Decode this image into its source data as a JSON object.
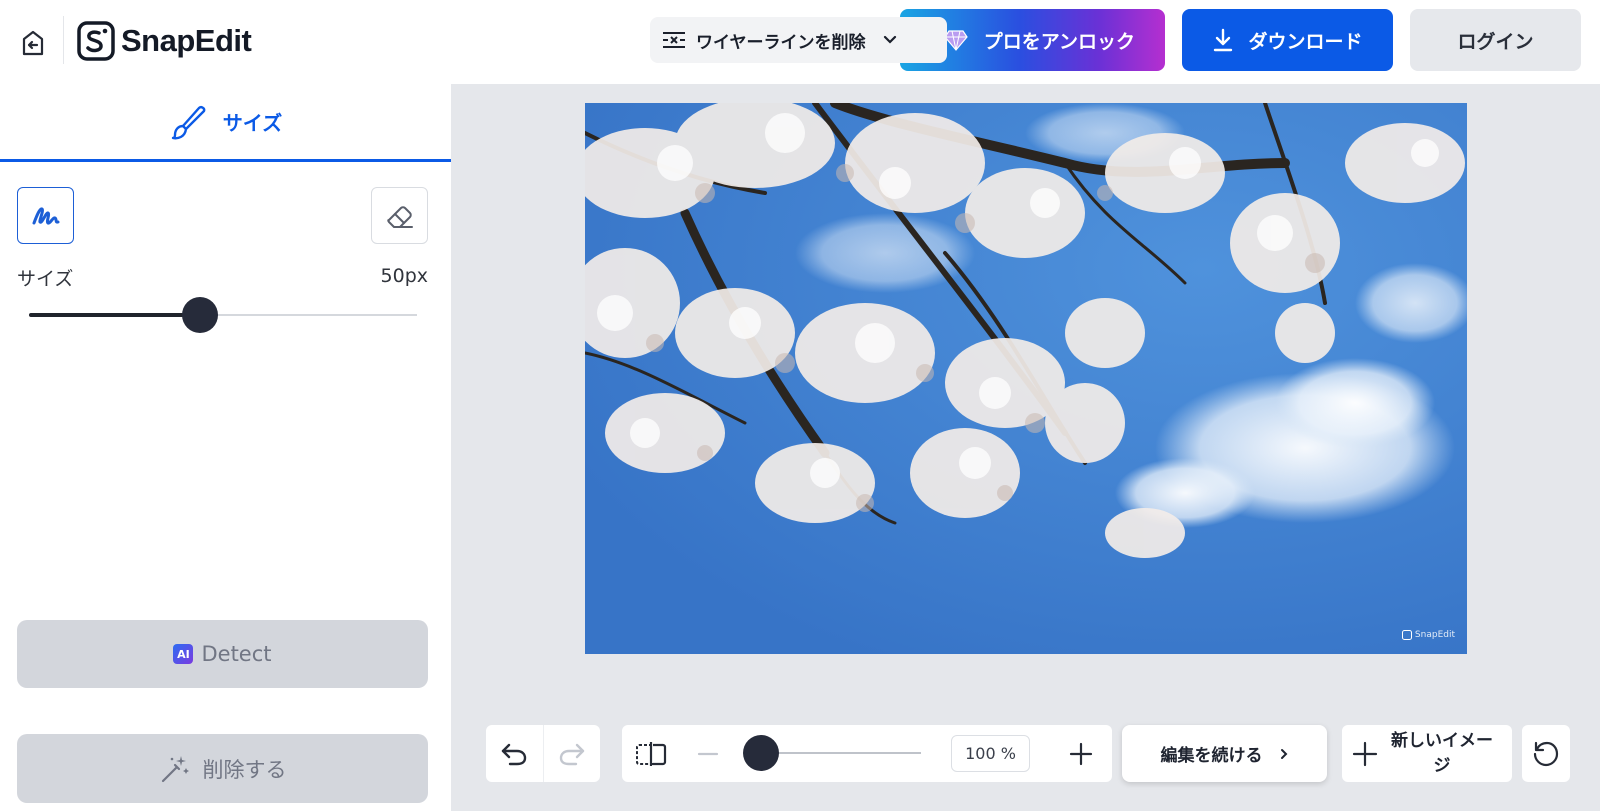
{
  "header": {
    "app_name": "SnapEdit",
    "tool_select_label": "ワイヤーラインを削除",
    "pro_button_label": "プロをアンロック",
    "download_button_label": "ダウンロード",
    "login_button_label": "ログイン"
  },
  "left_panel": {
    "tab_label": "サイズ",
    "size_label": "サイズ",
    "size_value": "50px",
    "size_level_percent": 44,
    "detect_button_label": "Detect",
    "ai_badge": "AI",
    "delete_button_label": "削除する"
  },
  "canvas": {
    "watermark": "SnapEdit"
  },
  "toolbar": {
    "zoom_value": "100 %",
    "continue_label": "編集を続ける",
    "new_image_label": "新しいイメージ"
  },
  "colors": {
    "accent": "#0b5ae6",
    "thumb": "#262b3a",
    "canvas_bg": "#e5e7eb",
    "sky": "#4285d5"
  },
  "icons": [
    "back-arrow-icon",
    "snapedit-logo-icon",
    "wire-remove-icon",
    "chevron-down-icon",
    "gem-icon",
    "download-icon",
    "paintbrush-icon",
    "brush-stroke-icon",
    "eraser-icon",
    "magic-wand-icon",
    "undo-icon",
    "redo-icon",
    "compare-icon",
    "minus-icon",
    "plus-icon",
    "chevron-right-icon",
    "reset-icon"
  ]
}
